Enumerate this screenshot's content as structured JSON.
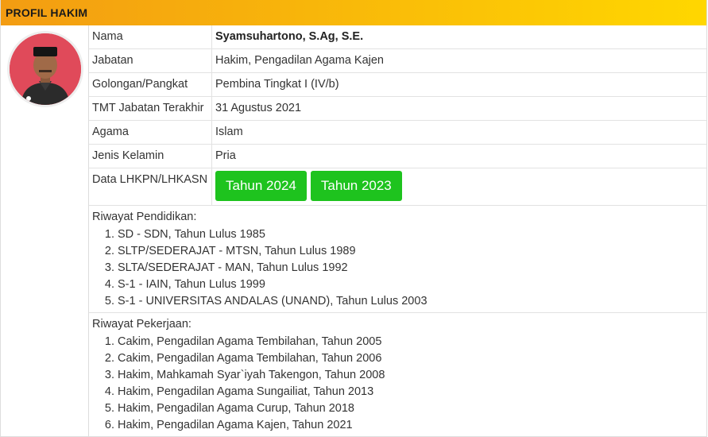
{
  "panel": {
    "title": "PROFIL HAKIM"
  },
  "profile": [
    {
      "label": "Nama",
      "value": "Syamsuhartono, S.Ag, S.E."
    },
    {
      "label": "Jabatan",
      "value": "Hakim, Pengadilan Agama Kajen"
    },
    {
      "label": "Golongan/Pangkat",
      "value": "Pembina Tingkat I (IV/b)"
    },
    {
      "label": "TMT Jabatan Terakhir",
      "value": "31 Agustus 2021"
    },
    {
      "label": "Agama",
      "value": "Islam"
    },
    {
      "label": "Jenis Kelamin",
      "value": "Pria"
    }
  ],
  "lhkpn": {
    "label": "Data LHKPN/LHKASN",
    "buttons": [
      "Tahun 2024",
      "Tahun 2023"
    ],
    "button_color": "#1ec31e"
  },
  "pendidikan": {
    "title": "Riwayat Pendidikan:",
    "items": [
      "SD - SDN, Tahun Lulus 1985",
      "SLTP/SEDERAJAT - MTSN, Tahun Lulus 1989",
      "SLTA/SEDERAJAT - MAN, Tahun Lulus 1992",
      "S-1 - IAIN, Tahun Lulus 1999",
      "S-1 - UNIVERSITAS ANDALAS (UNAND), Tahun Lulus 2003"
    ]
  },
  "pekerjaan": {
    "title": "Riwayat Pekerjaan:",
    "items": [
      "Cakim, Pengadilan Agama Tembilahan, Tahun 2005",
      "Cakim, Pengadilan Agama Tembilahan, Tahun 2006",
      "Hakim, Mahkamah Syar`iyah Takengon, Tahun 2008",
      "Hakim, Pengadilan Agama Sungailiat, Tahun 2013",
      "Hakim, Pengadilan Agama Curup, Tahun 2018",
      "Hakim, Pengadilan Agama Kajen, Tahun 2021"
    ]
  },
  "colors": {
    "header_start": "#f39c12",
    "header_end": "#ffd700",
    "avatar_bg": "#e04a5a"
  }
}
